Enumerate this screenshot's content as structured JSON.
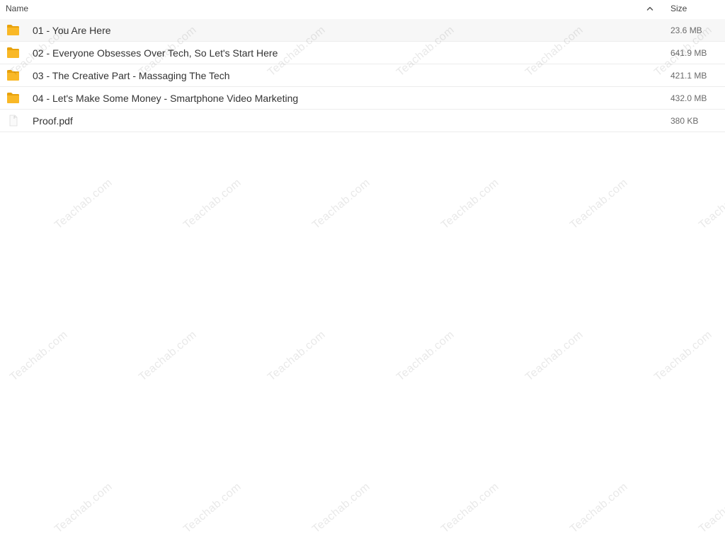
{
  "header": {
    "name_label": "Name",
    "size_label": "Size",
    "sort_icon": "chevron-up-icon"
  },
  "files": [
    {
      "type": "folder",
      "icon": "folder-icon",
      "name": "01 - You Are Here",
      "size": "23.6 MB"
    },
    {
      "type": "folder",
      "icon": "folder-icon",
      "name": "02 - Everyone Obsesses Over Tech, So Let's Start Here",
      "size": "641.9 MB"
    },
    {
      "type": "folder",
      "icon": "folder-icon",
      "name": "03 - The Creative Part - Massaging The Tech",
      "size": "421.1 MB"
    },
    {
      "type": "folder",
      "icon": "folder-icon",
      "name": "04 - Let's Make Some Money - Smartphone Video Marketing",
      "size": "432.0 MB"
    },
    {
      "type": "file",
      "icon": "pdf-file-icon",
      "name": "Proof.pdf",
      "size": "380 KB"
    }
  ],
  "watermark_text": "Teachab.com",
  "colors": {
    "folder": "#f9b826",
    "folder_dark": "#e8a20c"
  }
}
